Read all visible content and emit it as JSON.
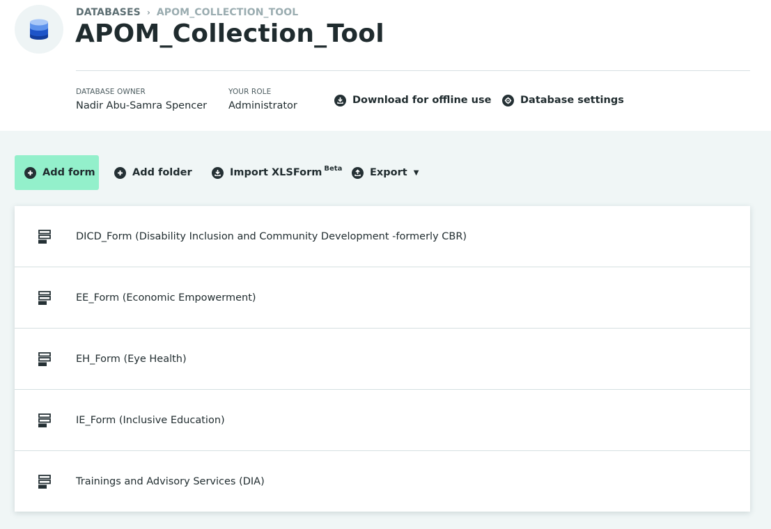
{
  "breadcrumb": {
    "root": "DATABASES",
    "separator": "›",
    "current": "APOM_COLLECTION_TOOL"
  },
  "page_title": "APOM_Collection_Tool",
  "database_icon": "database-icon",
  "meta": {
    "owner_label": "DATABASE OWNER",
    "owner_value": "Nadir Abu-Samra Spencer",
    "role_label": "YOUR ROLE",
    "role_value": "Administrator"
  },
  "header_actions": {
    "download": {
      "label": "Download for offline use",
      "icon": "download-icon"
    },
    "settings": {
      "label": "Database settings",
      "icon": "gear-icon"
    }
  },
  "toolbar": {
    "add_form": {
      "label": "Add form",
      "icon": "plus-circle-icon"
    },
    "add_folder": {
      "label": "Add folder",
      "icon": "plus-circle-icon"
    },
    "import": {
      "label": "Import XLSForm",
      "badge": "Beta",
      "icon": "import-icon"
    },
    "export": {
      "label": "Export",
      "caret": "▼",
      "icon": "export-icon"
    }
  },
  "forms": [
    {
      "label": "DICD_Form (Disability Inclusion and Community Development -formerly CBR)",
      "icon": "form-icon"
    },
    {
      "label": "EE_Form (Economic Empowerment)",
      "icon": "form-icon"
    },
    {
      "label": "EH_Form (Eye Health)",
      "icon": "form-icon"
    },
    {
      "label": "IE_Form (Inclusive Education)",
      "icon": "form-icon"
    },
    {
      "label": "Trainings and Advisory Services (DIA)",
      "icon": "form-icon"
    }
  ],
  "colors": {
    "accent_button": "#93f0cb",
    "page_background": "#f0f6f6",
    "text_dark": "#1f2b2e",
    "icon_dark": "#243034",
    "database_blue_top": "#9cc0f7",
    "database_blue_mid": "#2f6be0",
    "database_blue_bottom": "#123d9c"
  }
}
